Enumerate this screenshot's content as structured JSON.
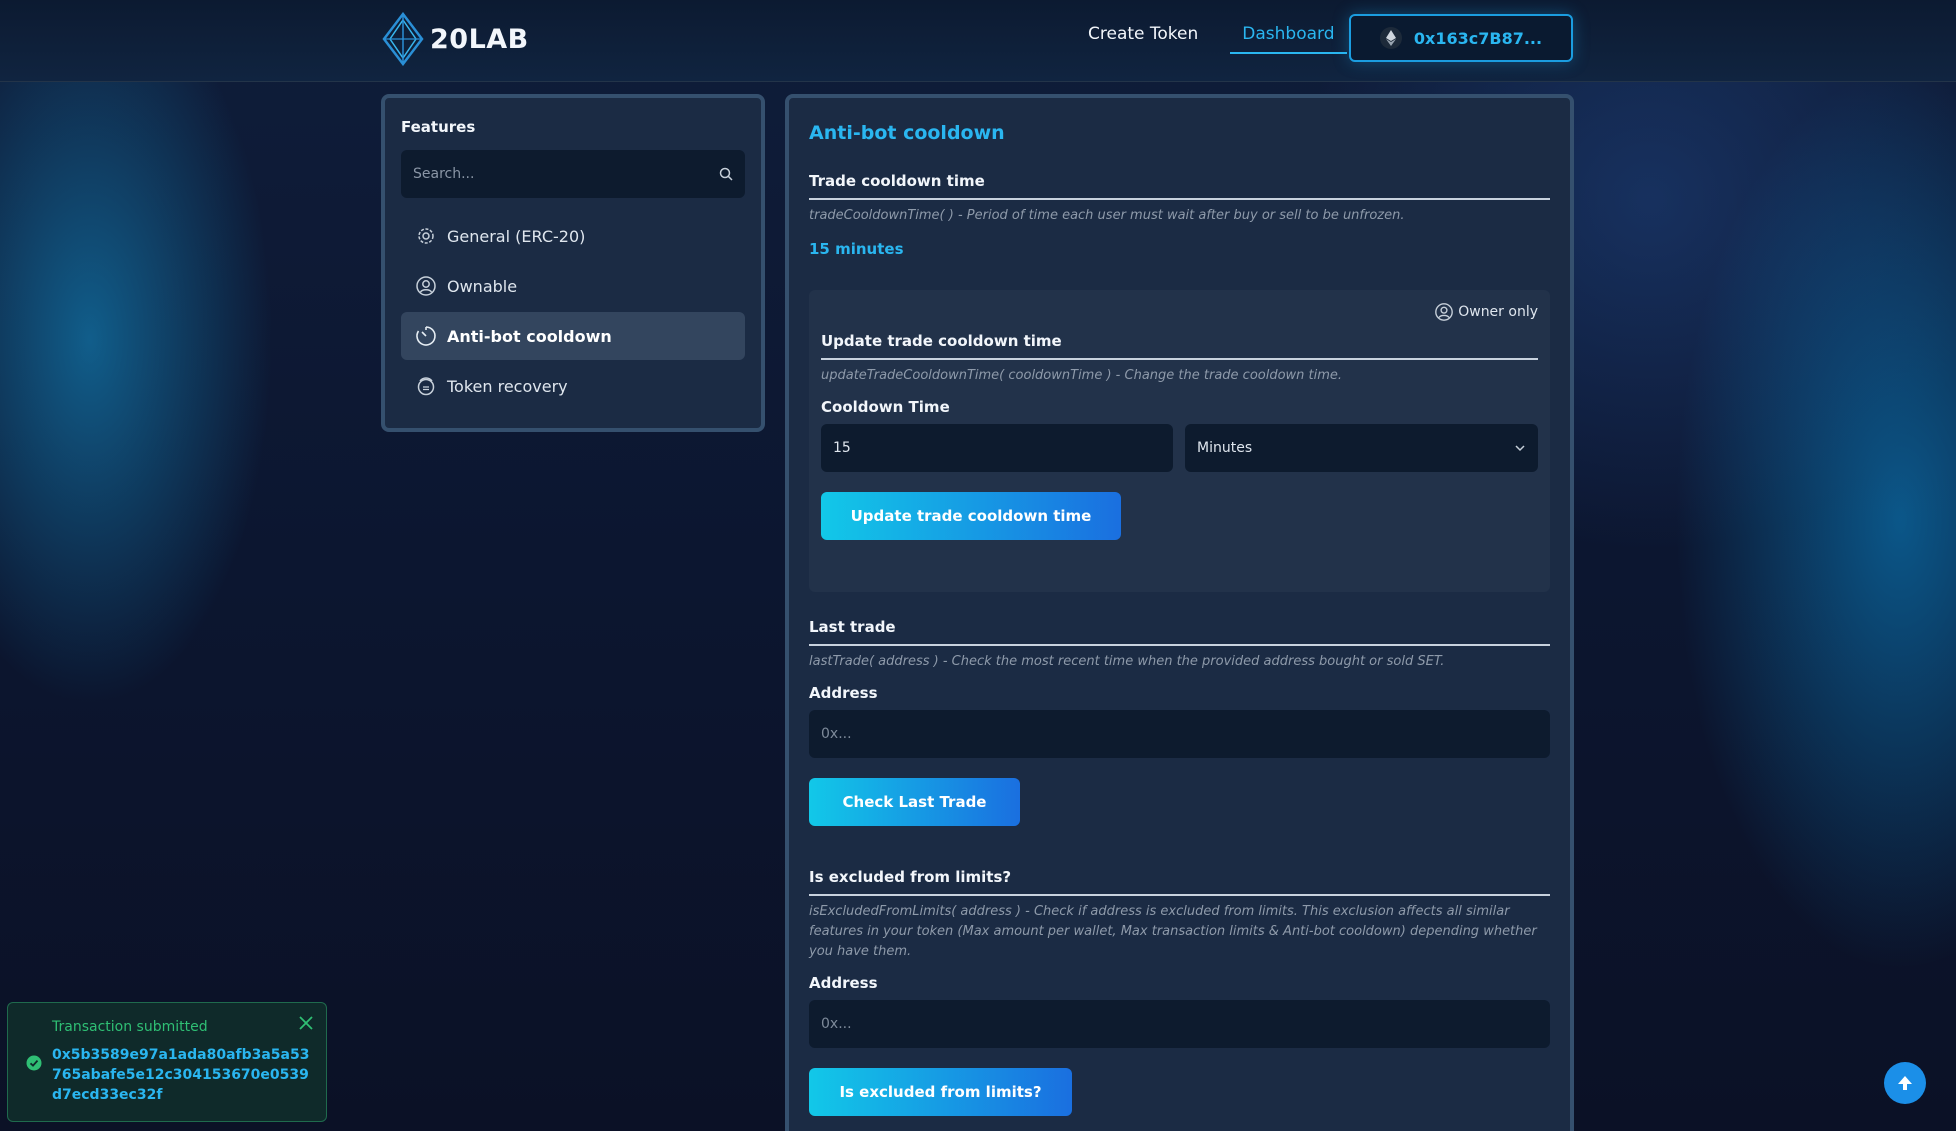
{
  "header": {
    "logo_text": "20LAB",
    "nav": [
      {
        "label": "Create Token"
      },
      {
        "label": "Dashboard"
      }
    ],
    "wallet_address": "0x163c7B87..."
  },
  "sidebar": {
    "title": "Features",
    "search_placeholder": "Search...",
    "items": [
      {
        "label": "General (ERC-20)",
        "icon": "gear-icon"
      },
      {
        "label": "Ownable",
        "icon": "user-circle-icon"
      },
      {
        "label": "Anti-bot cooldown",
        "icon": "timer-icon",
        "active": true
      },
      {
        "label": "Token recovery",
        "icon": "recovery-icon"
      }
    ]
  },
  "main": {
    "title": "Anti-bot cooldown",
    "trade_cooldown": {
      "title": "Trade cooldown time",
      "description": "tradeCooldownTime( ) - Period of time each user must wait after buy or sell to be unfrozen.",
      "value": "15 minutes"
    },
    "update_cooldown": {
      "owner_label": "Owner only",
      "title": "Update trade cooldown time",
      "description": "updateTradeCooldownTime( cooldownTime ) - Change the trade cooldown time.",
      "field_label": "Cooldown Time",
      "field_value": "15",
      "unit_selected": "Minutes",
      "button_label": "Update trade cooldown time"
    },
    "last_trade": {
      "title": "Last trade",
      "description": "lastTrade( address ) - Check the most recent time when the provided address bought or sold SET.",
      "field_label": "Address",
      "field_placeholder": "0x...",
      "button_label": "Check Last Trade"
    },
    "excluded": {
      "title": "Is excluded from limits?",
      "description": "isExcludedFromLimits( address ) - Check if address is excluded from limits. This exclusion affects all similar features in your token (Max amount per wallet, Max transaction limits & Anti-bot cooldown) depending whether you have them.",
      "field_label": "Address",
      "field_placeholder": "0x...",
      "button_label": "Is excluded from limits?"
    }
  },
  "toast": {
    "title": "Transaction submitted",
    "message": "0x5b3589e97a1ada80afb3a5a53765abafe5e12c304153670e0539d7ecd33ec32f"
  }
}
